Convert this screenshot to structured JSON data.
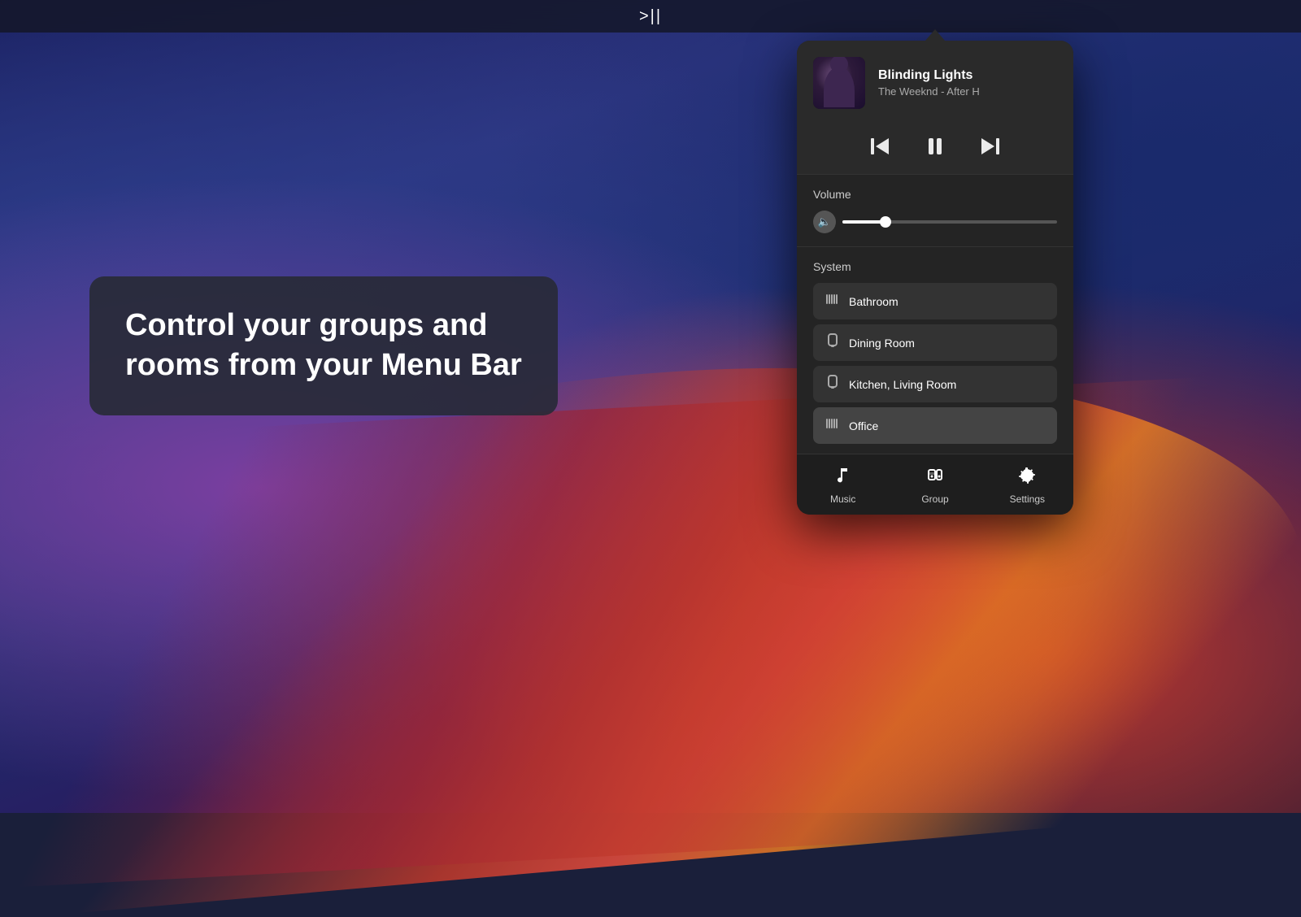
{
  "menuBar": {
    "playPauseLabel": ">||"
  },
  "infoTooltip": {
    "text": "Control your groups and\nrooms from your Menu Bar"
  },
  "nowPlaying": {
    "trackTitle": "Blinding Lights",
    "trackArtist": "The Weeknd - After H"
  },
  "volumeSection": {
    "label": "Volume",
    "level": 20
  },
  "systemSection": {
    "label": "System",
    "rooms": [
      {
        "name": "Bathroom",
        "icon": "bars-icon",
        "active": false
      },
      {
        "name": "Dining Room",
        "icon": "speaker-icon",
        "active": false
      },
      {
        "name": "Kitchen, Living Room",
        "icon": "speaker-icon",
        "active": false
      },
      {
        "name": "Office",
        "icon": "bars-icon",
        "active": true
      }
    ]
  },
  "bottomNav": {
    "items": [
      {
        "label": "Music",
        "icon": "music-icon"
      },
      {
        "label": "Group",
        "icon": "group-icon"
      },
      {
        "label": "Settings",
        "icon": "settings-icon"
      }
    ]
  }
}
